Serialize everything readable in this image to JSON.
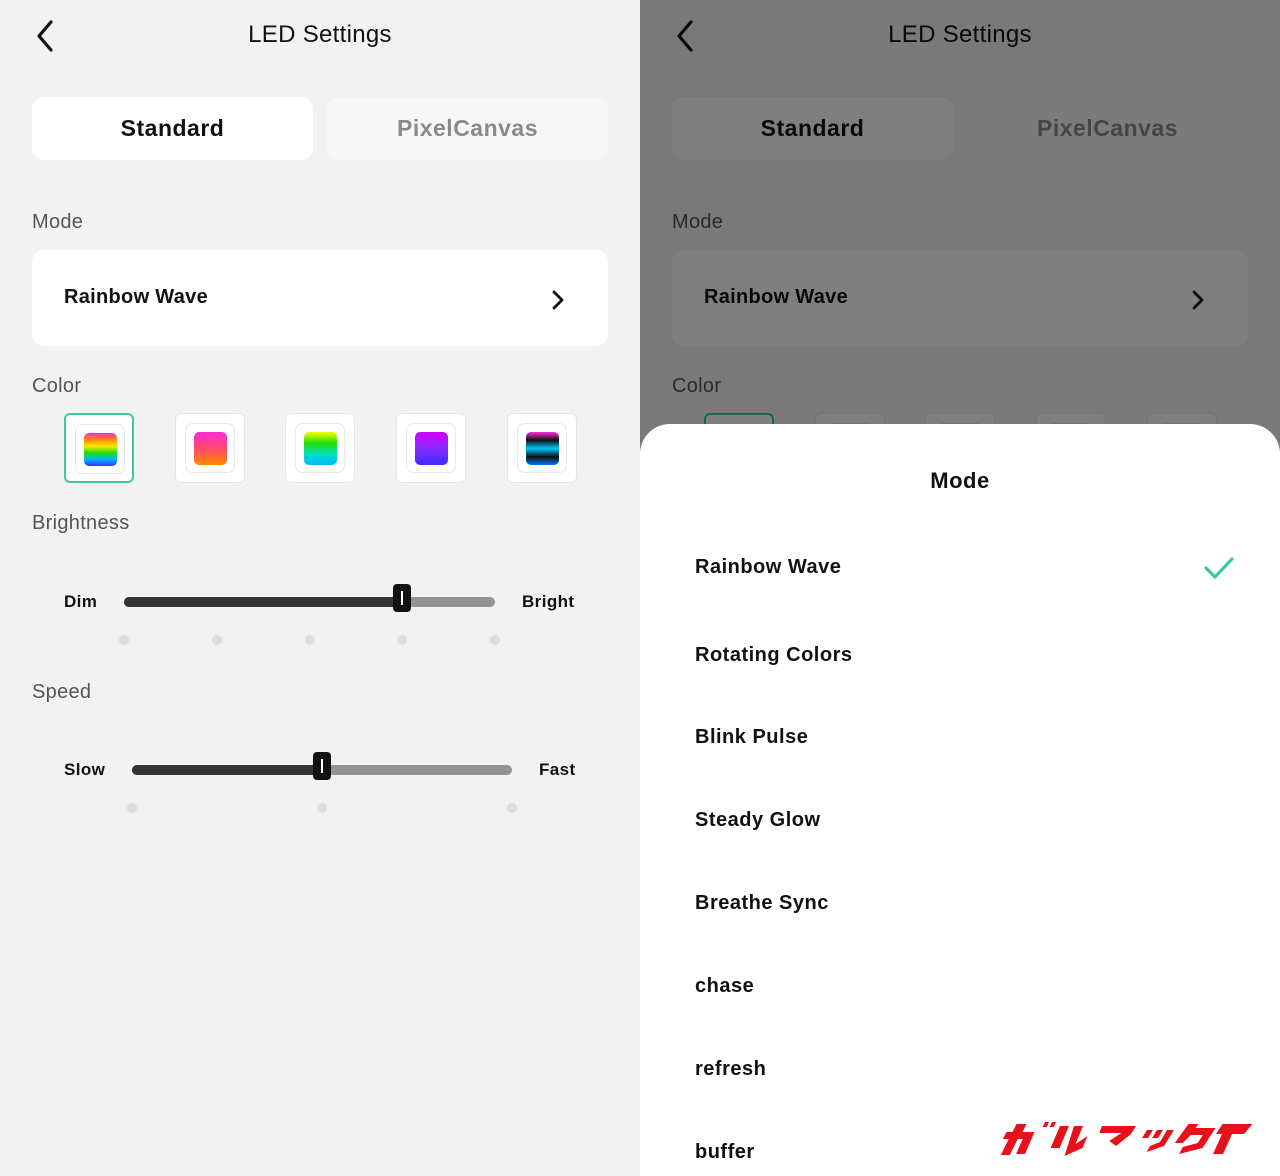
{
  "left_screen": {
    "header": {
      "title": "LED Settings"
    },
    "tabs": [
      {
        "label": "Standard",
        "active": true
      },
      {
        "label": "PixelCanvas",
        "active": false
      }
    ],
    "mode": {
      "label": "Mode",
      "value": "Rainbow Wave"
    },
    "color": {
      "label": "Color",
      "selected_index": 0,
      "swatches": [
        {
          "name": "rainbow-vertical",
          "colors": [
            "#ff2bd6",
            "#ff8a00",
            "#ffe600",
            "#22e000",
            "#00b8ff",
            "#3d2bff"
          ]
        },
        {
          "name": "pink-orange",
          "colors": [
            "#ff2bd6",
            "#ff4a6a",
            "#ff8a00"
          ]
        },
        {
          "name": "green-cyan",
          "colors": [
            "#f4ff00",
            "#22e000",
            "#00e0c0",
            "#00b8ff"
          ]
        },
        {
          "name": "purple-blue",
          "colors": [
            "#d000ff",
            "#8a2bff",
            "#3d2bff"
          ]
        },
        {
          "name": "dark-stripes",
          "colors": [
            "#ff2bd6",
            "#111111",
            "#00c8ff",
            "#111111",
            "#0077ff"
          ]
        }
      ]
    },
    "brightness": {
      "label": "Brightness",
      "min_label": "Dim",
      "max_label": "Bright",
      "value": 0.75,
      "steps": 5
    },
    "speed": {
      "label": "Speed",
      "min_label": "Slow",
      "max_label": "Fast",
      "value": 0.5,
      "steps": 3
    }
  },
  "right_screen": {
    "header": {
      "title": "LED Settings"
    },
    "tabs": [
      {
        "label": "Standard",
        "active": true
      },
      {
        "label": "PixelCanvas",
        "active": false
      }
    ],
    "mode": {
      "label": "Mode",
      "value": "Rainbow Wave"
    },
    "color": {
      "label": "Color"
    },
    "sheet": {
      "title": "Mode",
      "options": [
        "Rainbow Wave",
        "Rotating Colors",
        "Blink Pulse",
        "Steady Glow",
        "Breathe Sync",
        "chase",
        "refresh",
        "buffer"
      ],
      "selected_index": 0
    }
  },
  "colors": {
    "accent": "#3cc8a0",
    "watermark": "#e8101a"
  },
  "watermark": {
    "text": "ガルマックス"
  }
}
